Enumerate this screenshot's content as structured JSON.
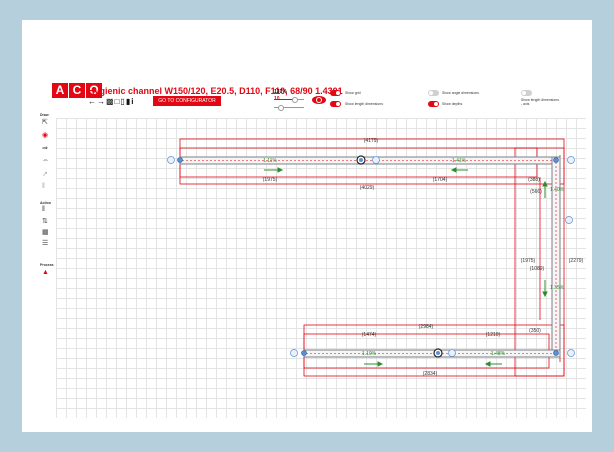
{
  "app": {
    "logo_letters": [
      "A",
      "C",
      "O"
    ],
    "title": "Hygienic channel W150/120, E20.5, D110, F110, 68/90 1.4301",
    "configurator_button": "GO TO CONFIGURATOR",
    "zoom_level": "137%",
    "depth_value": "10",
    "depth_slider_level": 0.55
  },
  "toolbar_icons": [
    "arrow-left-icon",
    "arrow-right-icon",
    "lock-icon",
    "folder-icon",
    "document-icon",
    "trash-icon",
    "info-icon"
  ],
  "toggles": [
    {
      "label": "Show grid",
      "on": true
    },
    {
      "label": "Show angle dimensions",
      "on": false
    },
    {
      "label": "Show length dimensions",
      "on": true
    },
    {
      "label": "Show depths",
      "on": true
    },
    {
      "label": "Show length dimensions - axis",
      "on": false
    }
  ],
  "sidebar": {
    "draw_heading": "Draw",
    "action_heading": "Action",
    "process_heading": "Process"
  },
  "dimensions": {
    "top_total": "(4179)",
    "top_left_seg": "(1975)",
    "top_right_seg": "(1704)",
    "top_inner": "(4029)",
    "top_corner": "(388)",
    "right_corner_top": "(566)",
    "right_inner_a": "(1975)",
    "right_inner_b": "(1089)",
    "right_total": "(2279)",
    "bottom_total": "(2984)",
    "bottom_left_seg": "(1474)",
    "bottom_right_seg": "(1210)",
    "bottom_corner": "(350)",
    "bottom_outer": "(2834)"
  },
  "slopes": {
    "top_left": "1.11%",
    "top_right": "1.41%",
    "right_top": "1.40%",
    "right_bottom": "1.35%",
    "bottom_left": "1.10%",
    "bottom_right": "1.48%"
  },
  "colors": {
    "accent": "#e30613",
    "flow_arrow": "#2e8b2e",
    "node": "#5b8fd6",
    "channel": "#8a8f95"
  }
}
